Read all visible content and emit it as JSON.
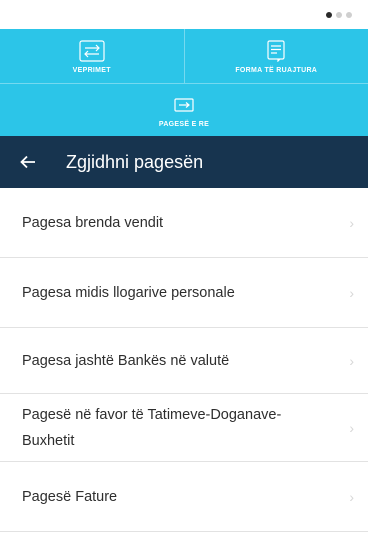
{
  "actions": {
    "movements_label": "VEPRIMET",
    "saved_forms_label": "FORMA TË RUAJTURA",
    "new_payment_label": "PAGESË E RE"
  },
  "header": {
    "title": "Zgjidhni pagesën"
  },
  "payment_types": [
    {
      "label": "Pagesa brenda vendit"
    },
    {
      "label": "Pagesa midis llogarive personale"
    },
    {
      "label": "Pagesa jashtë Bankës në valutë"
    },
    {
      "label": "Pagesë në favor të Tatimeve-Doganave-Buxhetit"
    },
    {
      "label": "Pagesë Fature"
    }
  ],
  "colors": {
    "accent": "#2cc5e8",
    "header": "#17344f",
    "text": "#2e2e2e",
    "divider": "#e2e2e2"
  },
  "icons": {
    "movements": "transfer-arrows-icon",
    "saved_forms": "document-icon",
    "new_payment": "banknote-icon",
    "back": "arrow-left-icon",
    "chevron": "chevron-right-icon"
  }
}
